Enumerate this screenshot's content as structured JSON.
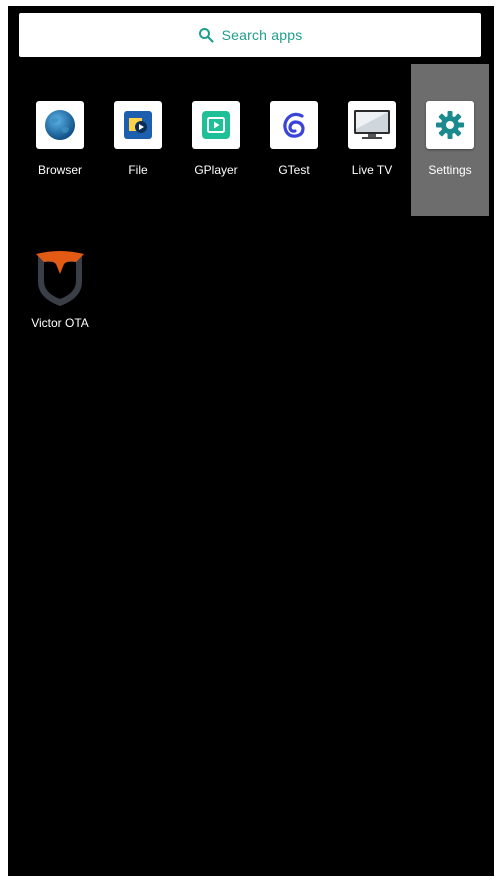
{
  "search": {
    "label": "Search apps"
  },
  "apps": [
    {
      "label": "Browser"
    },
    {
      "label": "File"
    },
    {
      "label": "GPlayer"
    },
    {
      "label": "GTest"
    },
    {
      "label": "Live TV"
    },
    {
      "label": "Settings",
      "selected": true
    },
    {
      "label": "Victor OTA"
    }
  ],
  "colors": {
    "search_accent": "#1f9e8b",
    "selection_highlight": "#6d6d6d",
    "background": "#000000"
  }
}
